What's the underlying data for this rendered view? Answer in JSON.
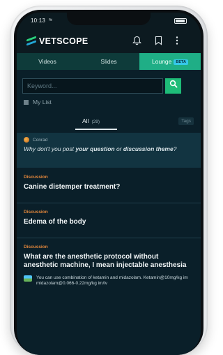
{
  "status": {
    "time": "10:13",
    "wifi_icon": "wifi-icon"
  },
  "app": {
    "name": "VETSCOPE",
    "brand_green": "#2bd27d",
    "brand_blue": "#23a7d6"
  },
  "header_icons": [
    "bell-icon",
    "bookmark-icon",
    "more-vertical-icon"
  ],
  "tabs": [
    {
      "label": "Videos",
      "active": false
    },
    {
      "label": "Slides",
      "active": false
    },
    {
      "label": "Lounge",
      "active": true,
      "badge": "BETA"
    }
  ],
  "search": {
    "placeholder": "Keyword..."
  },
  "filters": {
    "my_list_label": "My List",
    "all_label": "All",
    "all_count": "(29)",
    "tags_label": "Tags"
  },
  "prompt": {
    "user": "Conrad",
    "text_prefix": "Why don't you post ",
    "bold1": "your question",
    "text_middle": " or ",
    "bold2": "discussion theme",
    "text_suffix": "?"
  },
  "posts": [
    {
      "category": "Discussion",
      "title": "Canine distemper treatment?"
    },
    {
      "category": "Discussion",
      "title": "Edema of the body"
    },
    {
      "category": "Discussion",
      "title": "What are the anesthetic protocol without anesthetic machine, I mean injectable anesthesia",
      "reply": "You can use combination of ketamin and midazolam. Ketamin@10mg/kg im midazolam@0.066-0.22mg/kg im/iv"
    }
  ],
  "colors": {
    "active_tab": "#1fae86",
    "tab_bg": "#0e3b3a",
    "category": "#e1863b",
    "search_button": "#1ebc78"
  }
}
